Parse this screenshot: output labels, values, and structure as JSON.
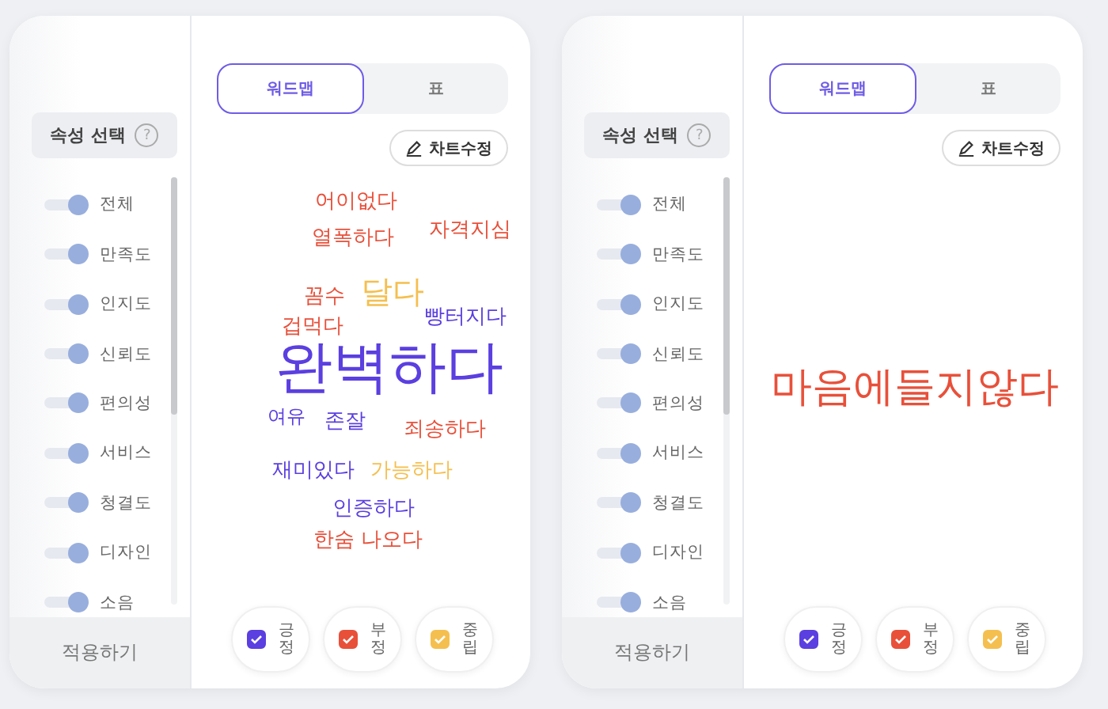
{
  "panels": [
    {
      "sidebar": {
        "header": "속성 선택",
        "help_icon": "?",
        "attributes": [
          {
            "label": "전체",
            "on": true
          },
          {
            "label": "만족도",
            "on": true
          },
          {
            "label": "인지도",
            "on": true
          },
          {
            "label": "신뢰도",
            "on": true
          },
          {
            "label": "편의성",
            "on": true
          },
          {
            "label": "서비스",
            "on": true
          },
          {
            "label": "청결도",
            "on": true
          },
          {
            "label": "디자인",
            "on": true
          },
          {
            "label": "소음",
            "on": true
          }
        ],
        "apply_button": "적용하기"
      },
      "tabs": [
        {
          "label": "워드맵",
          "selected": true
        },
        {
          "label": "표",
          "selected": false
        }
      ],
      "edit_button": "차트수정",
      "words": [
        {
          "text": "어이없다",
          "kind": "negative"
        },
        {
          "text": "열폭하다",
          "kind": "negative"
        },
        {
          "text": "자격지심",
          "kind": "negative"
        },
        {
          "text": "꼼수",
          "kind": "negative"
        },
        {
          "text": "달다",
          "kind": "neutral"
        },
        {
          "text": "빵터지다",
          "kind": "positive"
        },
        {
          "text": "겁먹다",
          "kind": "negative"
        },
        {
          "text": "완벽하다",
          "kind": "positive"
        },
        {
          "text": "여유",
          "kind": "positive"
        },
        {
          "text": "존잘",
          "kind": "positive"
        },
        {
          "text": "죄송하다",
          "kind": "negative"
        },
        {
          "text": "재미있다",
          "kind": "positive"
        },
        {
          "text": "가능하다",
          "kind": "neutral"
        },
        {
          "text": "인증하다",
          "kind": "positive"
        },
        {
          "text": "한숨 나오다",
          "kind": "negative"
        }
      ],
      "legend": [
        {
          "label": "긍정",
          "kind": "positive",
          "checked": true
        },
        {
          "label": "부정",
          "kind": "negative",
          "checked": true
        },
        {
          "label": "중립",
          "kind": "neutral",
          "checked": true
        }
      ]
    },
    {
      "sidebar": {
        "header": "속성 선택",
        "help_icon": "?",
        "attributes": [
          {
            "label": "전체",
            "on": true
          },
          {
            "label": "만족도",
            "on": true
          },
          {
            "label": "인지도",
            "on": true
          },
          {
            "label": "신뢰도",
            "on": true
          },
          {
            "label": "편의성",
            "on": true
          },
          {
            "label": "서비스",
            "on": true
          },
          {
            "label": "청결도",
            "on": true
          },
          {
            "label": "디자인",
            "on": true
          },
          {
            "label": "소음",
            "on": true
          }
        ],
        "apply_button": "적용하기"
      },
      "tabs": [
        {
          "label": "워드맵",
          "selected": true
        },
        {
          "label": "표",
          "selected": false
        }
      ],
      "edit_button": "차트수정",
      "words": [
        {
          "text": "마음에들지않다",
          "kind": "negative"
        }
      ],
      "legend": [
        {
          "label": "긍정",
          "kind": "positive",
          "checked": true
        },
        {
          "label": "부정",
          "kind": "negative",
          "checked": true
        },
        {
          "label": "중립",
          "kind": "neutral",
          "checked": true
        }
      ]
    }
  ]
}
